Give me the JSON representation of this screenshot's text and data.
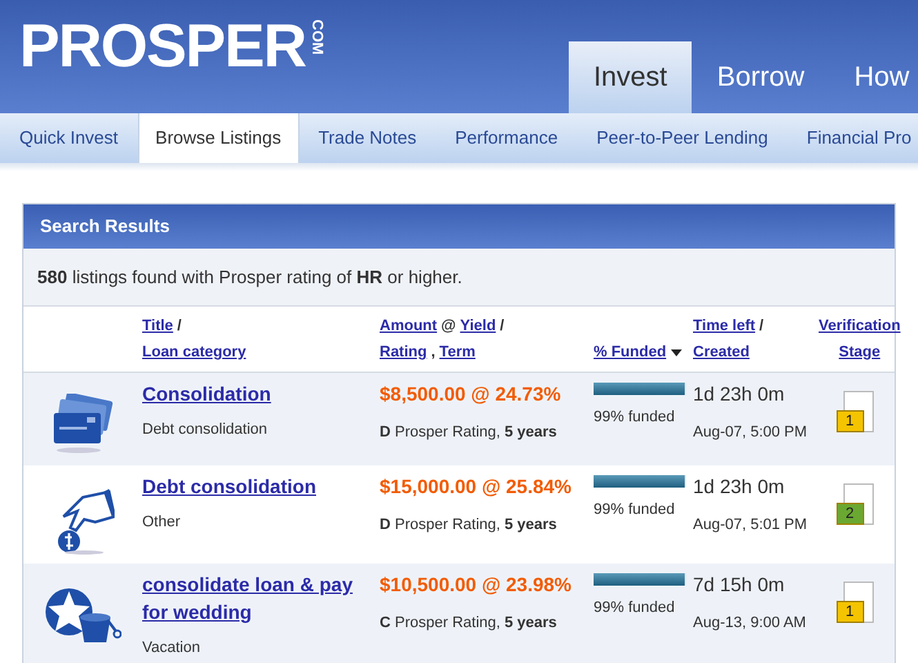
{
  "logo": {
    "text": "PROSPER",
    "suffix": "COM"
  },
  "main_tabs": [
    {
      "label": "Invest",
      "selected": true
    },
    {
      "label": "Borrow",
      "selected": false
    },
    {
      "label": "How",
      "selected": false
    }
  ],
  "sub_nav": [
    {
      "label": "Quick Invest",
      "selected": false
    },
    {
      "label": "Browse Listings",
      "selected": true
    },
    {
      "label": "Trade Notes",
      "selected": false
    },
    {
      "label": "Performance",
      "selected": false
    },
    {
      "label": "Peer-to-Peer Lending",
      "selected": false
    },
    {
      "label": "Financial Pro",
      "selected": false
    }
  ],
  "panel": {
    "title": "Search Results",
    "summary": "**580** listings found with Prosper rating of **HR** or higher."
  },
  "columns": [
    {
      "lines": [
        [
          {
            "text": "Title",
            "kind": "link"
          },
          {
            "text": "/",
            "kind": "text"
          }
        ],
        [
          {
            "text": "Loan category",
            "kind": "link"
          }
        ]
      ]
    },
    {
      "lines": [
        [
          {
            "text": "Amount",
            "kind": "link"
          },
          {
            "text": "@",
            "kind": "text"
          },
          {
            "text": "Yield",
            "kind": "link"
          },
          {
            "text": "/",
            "kind": "text"
          }
        ],
        [
          {
            "text": "Rating",
            "kind": "link"
          },
          {
            "text": ",",
            "kind": "text"
          },
          {
            "text": "Term",
            "kind": "link"
          }
        ]
      ]
    },
    {
      "sorted": true,
      "lines": [
        [
          {
            "text": "% Funded",
            "kind": "link"
          }
        ]
      ]
    },
    {
      "lines": [
        [
          {
            "text": "Time left",
            "kind": "link"
          },
          {
            "text": "/",
            "kind": "text"
          }
        ],
        [
          {
            "text": "Created",
            "kind": "link"
          }
        ]
      ]
    },
    {
      "lines": [
        [
          {
            "text": "Verification",
            "kind": "link"
          }
        ],
        [
          {
            "text": "Stage",
            "kind": "link"
          }
        ]
      ]
    }
  ],
  "listings": [
    {
      "kind": "cards",
      "title": "Consolidation",
      "category": "Debt consolidation",
      "amount": "$8,500.00 @ 24.73%",
      "rating": "**D** Prosper Rating, **5 years**",
      "level": 0.99,
      "funded": "99% funded",
      "time_left": "1d 23h 0m",
      "created": "Aug-07, 5:00 PM",
      "stage": "1",
      "color": "#f5c400"
    },
    {
      "kind": "hand",
      "title": "Debt consolidation",
      "category": "Other",
      "amount": "$15,000.00 @ 25.84%",
      "rating": "**D** Prosper Rating, **5 years**",
      "level": 0.99,
      "funded": "99% funded",
      "time_left": "1d 23h 0m",
      "created": "Aug-07, 5:01 PM",
      "stage": "2",
      "color": "#6aa832"
    },
    {
      "kind": "beach",
      "title": "consolidate loan & pay for wedding",
      "category": "Vacation",
      "amount": "$10,500.00 @ 23.98%",
      "rating": "**C** Prosper Rating, **5 years**",
      "level": 0.99,
      "funded": "99% funded",
      "time_left": "7d 15h 0m",
      "created": "Aug-13, 9:00 AM",
      "stage": "1",
      "color": "#f5c400"
    }
  ]
}
